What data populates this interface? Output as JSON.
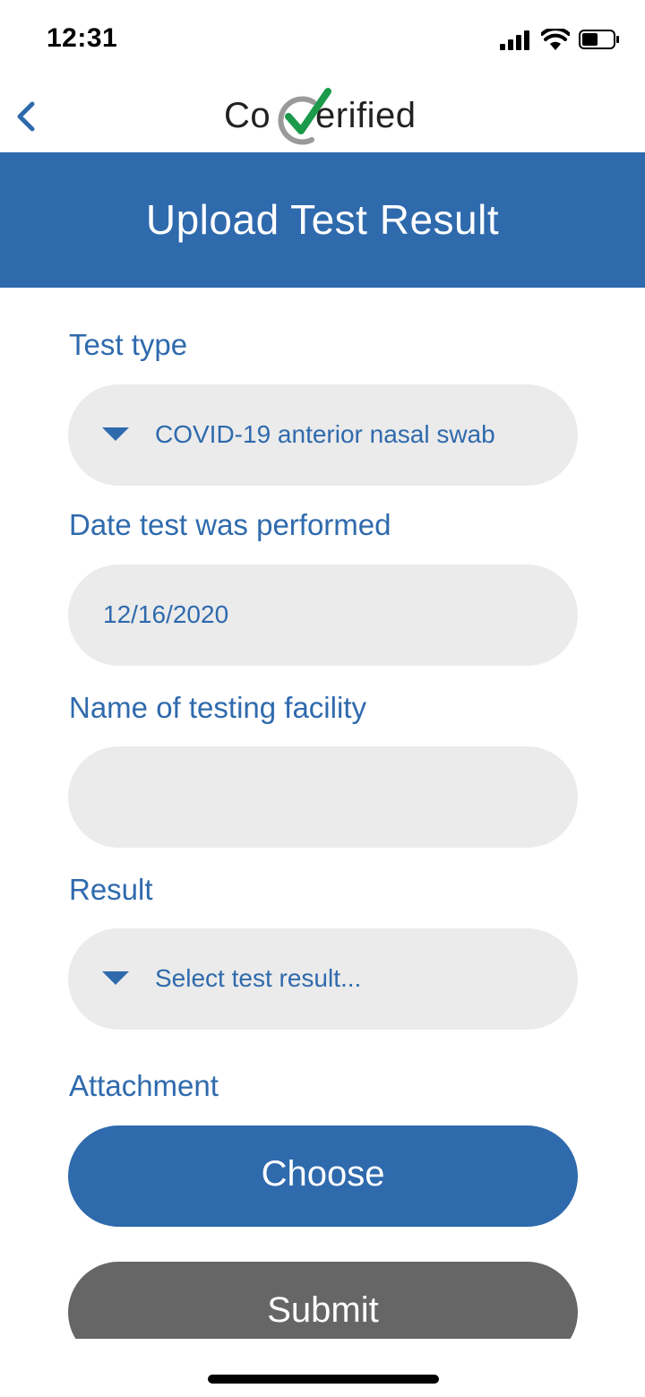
{
  "status_bar": {
    "time": "12:31"
  },
  "logo": {
    "prefix": "Co",
    "suffix": "erified"
  },
  "header": {
    "title": "Upload Test Result"
  },
  "form": {
    "test_type": {
      "label": "Test type",
      "value": "COVID-19 anterior nasal swab"
    },
    "date": {
      "label": "Date test was performed",
      "value": "12/16/2020"
    },
    "facility": {
      "label": "Name of testing facility",
      "value": ""
    },
    "result": {
      "label": "Result",
      "placeholder": "Select test result..."
    },
    "attachment": {
      "label": "Attachment"
    }
  },
  "buttons": {
    "choose": "Choose",
    "submit": "Submit"
  },
  "colors": {
    "accent": "#2f6aad",
    "field_bg": "#ebebeb",
    "submit_bg": "#666666",
    "logo_check": "#1a9a4a",
    "logo_ring": "#9a9a9a"
  },
  "icons": {
    "back": "chevron-left-icon",
    "dropdown": "caret-down-icon",
    "signal": "signal-icon",
    "wifi": "wifi-icon",
    "battery": "battery-icon"
  }
}
